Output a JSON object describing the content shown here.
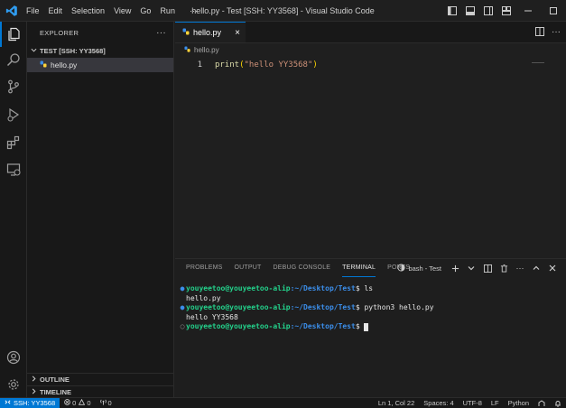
{
  "titlebar": {
    "menu": [
      "File",
      "Edit",
      "Selection",
      "View",
      "Go",
      "Run"
    ],
    "more": "···",
    "title": "hello.py - Test [SSH: YY3568] - Visual Studio Code"
  },
  "activity": [
    "explorer-icon",
    "search-icon",
    "source-control-icon",
    "run-debug-icon",
    "extensions-icon",
    "remote-explorer-icon",
    "account-icon",
    "settings-gear-icon"
  ],
  "sidebar": {
    "header": "EXPLORER",
    "more": "···",
    "folder": "TEST [SSH: YY3568]",
    "files": [
      {
        "name": "hello.py"
      }
    ],
    "outline": "OUTLINE",
    "timeline": "TIMELINE"
  },
  "editor": {
    "tab": {
      "label": "hello.py",
      "close": "×"
    },
    "breadcrumb": "hello.py",
    "lines": [
      {
        "num": "1",
        "fn": "print",
        "open": "(",
        "str": "\"hello YY3568\"",
        "close": ")"
      }
    ]
  },
  "panel": {
    "tabs": [
      "PROBLEMS",
      "OUTPUT",
      "DEBUG CONSOLE",
      "TERMINAL",
      "PORTS"
    ],
    "active_tab": "TERMINAL",
    "terminal_label": "bash - Test",
    "terminal": {
      "user": "youyeetoo@youyeetoo-alip",
      "path": ":~/Desktop/Test",
      "prompt": "$ ",
      "cmd1": "ls",
      "out1": "hello.py",
      "cmd2": "python3 hello.py",
      "out2": "hello YY3568"
    }
  },
  "statusbar": {
    "remote": "SSH: YY3568",
    "errors": "0",
    "warnings": "0",
    "ports": "0",
    "position": "Ln 1, Col 22",
    "spaces": "Spaces: 4",
    "encoding": "UTF-8",
    "eol": "LF",
    "language": "Python"
  },
  "colors": {
    "accent": "#0078d4",
    "terminal_user": "#23d18b",
    "terminal_path": "#3b8eea",
    "string": "#ce9178",
    "function": "#dcdcaa"
  }
}
